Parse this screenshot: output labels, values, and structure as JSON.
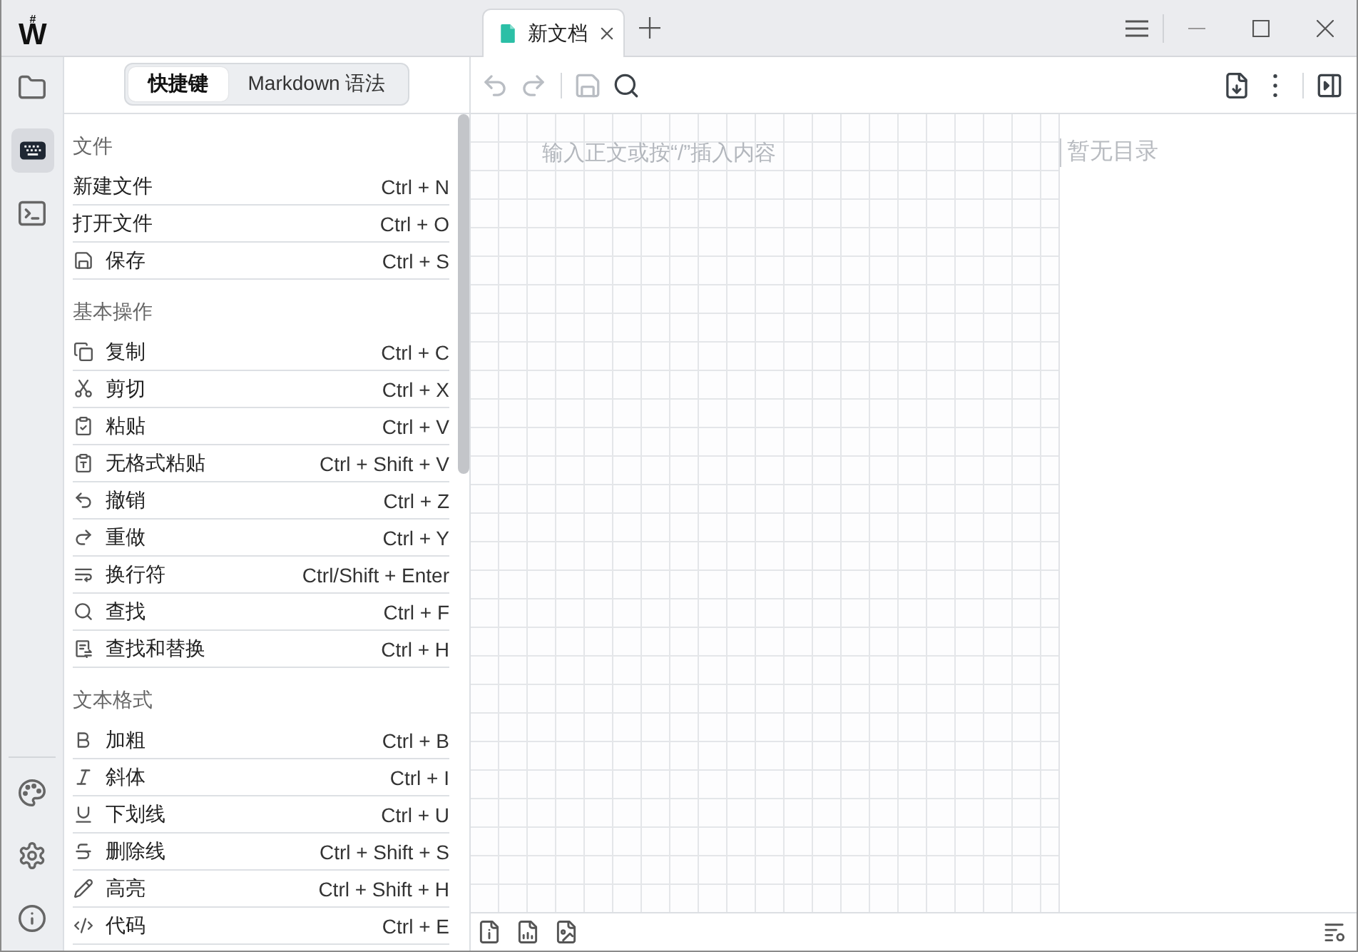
{
  "logo": {
    "mark": "#",
    "letter": "W"
  },
  "tabs": [
    {
      "title": "新文档",
      "selected": true
    }
  ],
  "activity_bar": [
    {
      "kind": "folder",
      "selected": false
    },
    {
      "kind": "keyboard",
      "selected": true
    },
    {
      "kind": "terminal",
      "selected": false
    }
  ],
  "panel_tabs": [
    {
      "label": "快捷键",
      "selected": true
    },
    {
      "label": "Markdown 语法",
      "selected": false
    }
  ],
  "sections": [
    {
      "title": "文件",
      "rows": [
        {
          "kind": "plain",
          "label": "新建文件",
          "keys": "Ctrl + N"
        },
        {
          "kind": "plain",
          "label": "打开文件",
          "keys": "Ctrl + O"
        },
        {
          "kind": "save",
          "label": "保存",
          "keys": "Ctrl + S"
        }
      ]
    },
    {
      "title": "基本操作",
      "rows": [
        {
          "kind": "copy",
          "label": "复制",
          "keys": "Ctrl + C"
        },
        {
          "kind": "cut",
          "label": "剪切",
          "keys": "Ctrl + X"
        },
        {
          "kind": "paste",
          "label": "粘贴",
          "keys": "Ctrl + V"
        },
        {
          "kind": "paste-plain",
          "label": "无格式粘贴",
          "keys": "Ctrl + Shift + V"
        },
        {
          "kind": "undo",
          "label": "撤销",
          "keys": "Ctrl + Z"
        },
        {
          "kind": "redo",
          "label": "重做",
          "keys": "Ctrl + Y"
        },
        {
          "kind": "line-break",
          "label": "换行符",
          "keys": "Ctrl/Shift + Enter"
        },
        {
          "kind": "find",
          "label": "查找",
          "keys": "Ctrl + F"
        },
        {
          "kind": "replace",
          "label": "查找和替换",
          "keys": "Ctrl + H"
        }
      ]
    },
    {
      "title": "文本格式",
      "rows": [
        {
          "kind": "bold",
          "label": "加粗",
          "keys": "Ctrl + B"
        },
        {
          "kind": "italic",
          "label": "斜体",
          "keys": "Ctrl + I"
        },
        {
          "kind": "underline",
          "label": "下划线",
          "keys": "Ctrl + U"
        },
        {
          "kind": "strikethrough",
          "label": "删除线",
          "keys": "Ctrl + Shift + S"
        },
        {
          "kind": "highlight",
          "label": "高亮",
          "keys": "Ctrl + Shift + H"
        },
        {
          "kind": "code",
          "label": "代码",
          "keys": "Ctrl + E"
        }
      ]
    }
  ],
  "toolbar": {
    "left": [
      [
        {
          "kind": "undo",
          "disabled": true
        },
        {
          "kind": "redo",
          "disabled": true
        }
      ],
      [
        {
          "kind": "save",
          "disabled": true
        },
        {
          "kind": "search",
          "disabled": false
        }
      ]
    ],
    "right": [
      [
        {
          "kind": "export",
          "disabled": false
        },
        {
          "kind": "more",
          "disabled": false
        }
      ],
      [
        {
          "kind": "outline-toggle",
          "disabled": false
        }
      ]
    ]
  },
  "editor": {
    "placeholder": "输入正文或按“/”插入内容"
  },
  "outline": {
    "empty_text": "暂无目录"
  }
}
